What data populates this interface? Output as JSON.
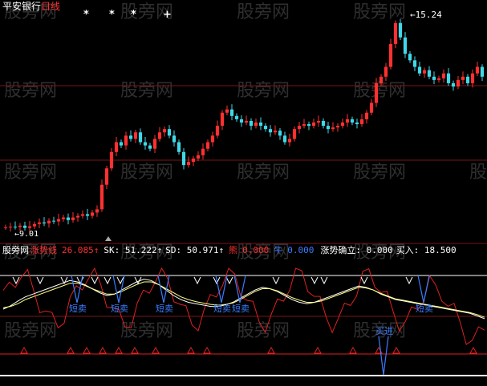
{
  "colors": {
    "background": "#000000",
    "grid": "#7a1414",
    "candle_up": "#ff3030",
    "candle_down": "#40d8e8",
    "white": "#ffffff",
    "yellow": "#ffff80",
    "red_line": "#e02020",
    "blue_signal": "#3a7cff",
    "watermark": "#555555"
  },
  "price_panel": {
    "title_prefix": "平安银行",
    "title_suffix": "日线",
    "star_markers": [
      "*",
      "*",
      "*",
      "+"
    ],
    "high_label": "←15.24",
    "low_label": "←9.01",
    "watermark": "股旁网"
  },
  "indicator_panel": {
    "header": {
      "brand": "股旁网",
      "name": "涨势线",
      "name_value": "26.085↑",
      "sk": "SK: 51.222↑",
      "sd": "SD: 50.971↑",
      "bear_label": "熊",
      "bear_value": "0.000",
      "bull_label": "牛",
      "bull_value": "0.000",
      "trend": "涨势确立: 0.000",
      "buy": "买入: 18.500"
    },
    "short_sell_labels": [
      "短卖",
      "短卖",
      "短卖",
      "短卖",
      "短卖",
      "短卖"
    ],
    "buy_label": "买进"
  },
  "chart_data": [
    {
      "type": "candlestick",
      "title": "平安银行 日线",
      "annotations": [
        "←15.24",
        "←9.01"
      ],
      "ylim": [
        8.8,
        15.6
      ],
      "close": [
        9.0,
        9.02,
        9.01,
        9.05,
        8.98,
        9.03,
        9.1,
        9.15,
        9.12,
        9.2,
        9.18,
        9.25,
        9.3,
        9.22,
        9.3,
        9.35,
        9.4,
        9.35,
        9.45,
        9.55,
        10.3,
        10.8,
        11.3,
        11.6,
        11.5,
        11.8,
        11.7,
        11.9,
        11.6,
        11.5,
        11.4,
        11.7,
        11.9,
        12.0,
        11.8,
        11.6,
        11.3,
        10.9,
        11.0,
        11.1,
        11.2,
        11.4,
        11.6,
        11.8,
        12.1,
        12.5,
        12.6,
        12.4,
        12.3,
        12.2,
        12.25,
        12.1,
        12.2,
        12.1,
        12.0,
        11.9,
        11.95,
        11.8,
        11.6,
        11.7,
        12.0,
        12.1,
        12.15,
        12.1,
        12.2,
        12.25,
        12.1,
        12.0,
        12.05,
        12.1,
        12.2,
        12.3,
        12.2,
        12.15,
        12.3,
        12.5,
        12.8,
        13.4,
        13.6,
        13.9,
        14.6,
        15.24,
        14.8,
        14.3,
        14.1,
        13.9,
        13.7,
        13.8,
        13.6,
        13.5,
        13.55,
        13.7,
        13.4,
        13.3,
        13.5,
        13.6,
        13.4,
        13.7,
        13.9,
        13.6
      ]
    },
    {
      "type": "line",
      "title": "涨势线",
      "series": [
        {
          "name": "SK",
          "values": [
            40,
            45,
            52,
            58,
            62,
            66,
            70,
            74,
            78,
            82,
            80,
            76,
            70,
            64,
            60,
            62,
            68,
            74,
            80,
            84,
            82,
            76,
            68,
            60,
            54,
            50,
            48,
            46,
            44,
            44,
            46,
            50,
            56,
            62,
            68,
            72,
            70,
            66,
            60,
            54,
            50,
            48,
            50,
            54,
            58,
            62,
            66,
            70,
            74,
            72,
            68,
            62,
            58,
            54,
            52,
            50,
            48,
            46,
            44,
            42,
            40,
            38,
            36,
            34,
            30,
            26
          ]
        },
        {
          "name": "SD",
          "values": [
            42,
            44,
            48,
            54,
            58,
            62,
            66,
            70,
            74,
            78,
            78,
            75,
            70,
            66,
            62,
            62,
            66,
            71,
            76,
            80,
            80,
            76,
            70,
            64,
            58,
            54,
            51,
            49,
            47,
            46,
            47,
            49,
            54,
            60,
            66,
            70,
            70,
            67,
            62,
            57,
            53,
            50,
            50,
            52,
            56,
            60,
            64,
            68,
            72,
            71,
            68,
            63,
            59,
            55,
            53,
            51,
            49,
            47,
            45,
            43,
            41,
            39,
            37,
            35,
            32,
            28
          ]
        }
      ],
      "values_text": {
        "涨势线": 26.085,
        "SK": 51.222,
        "SD": 50.971,
        "熊": 0.0,
        "牛": 0.0,
        "涨势确立": 0.0,
        "买入": 18.5
      }
    }
  ]
}
